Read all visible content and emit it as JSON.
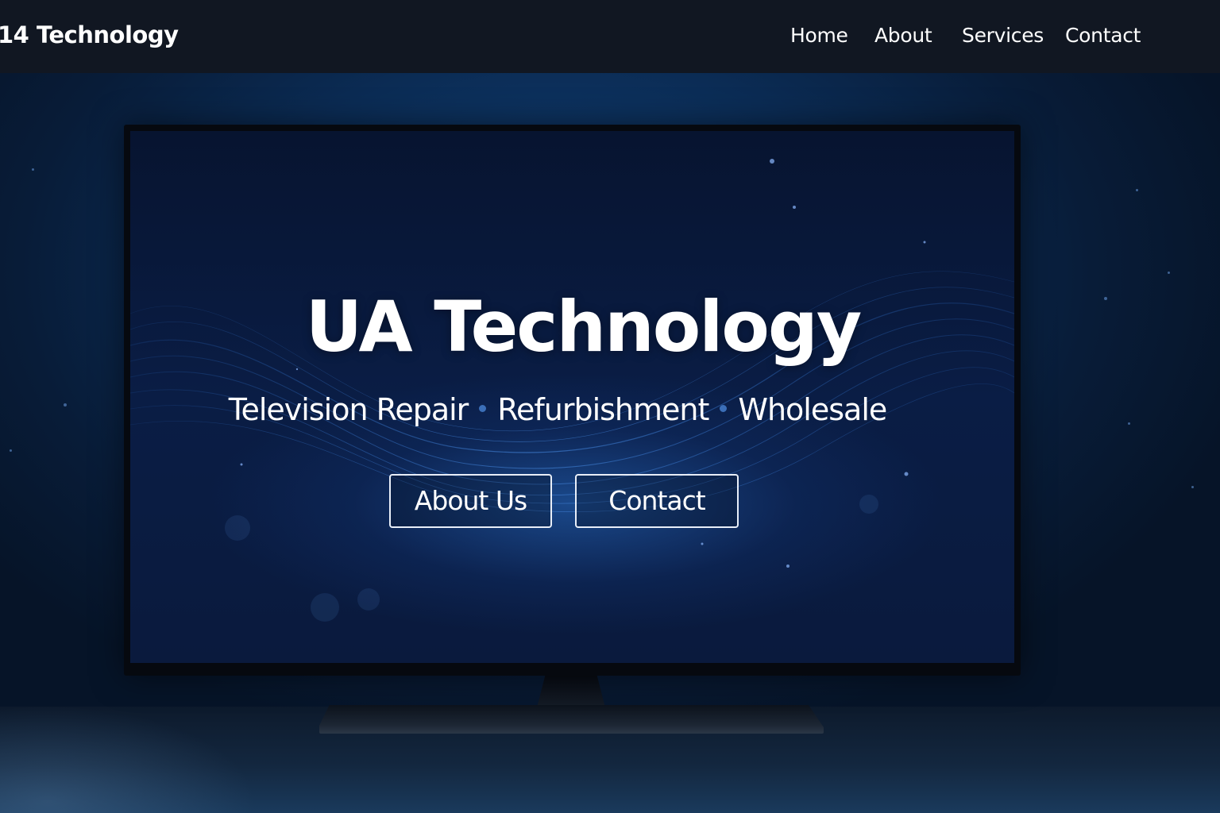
{
  "header": {
    "brand": "14 Technology",
    "nav": [
      {
        "label": "Home"
      },
      {
        "label": "About"
      },
      {
        "label": "Services"
      },
      {
        "label": "Contact"
      }
    ]
  },
  "hero": {
    "title": "UA Technology",
    "tagline": [
      "Television Repair",
      "Refurbishment",
      "Wholesale"
    ],
    "buttons": {
      "about": "About Us",
      "contact": "Contact"
    }
  },
  "colors": {
    "header_bg": "#111722",
    "accent": "#3b6fb8",
    "background": "#0b2c55"
  }
}
